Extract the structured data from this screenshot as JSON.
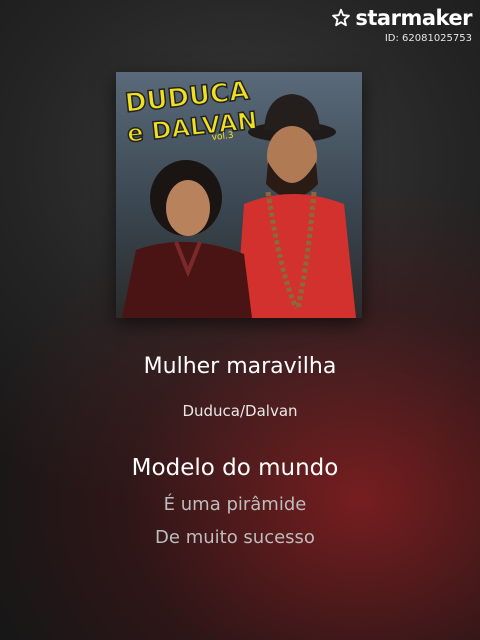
{
  "app": {
    "brand_name": "starmaker",
    "id_text": "ID: 62081025753",
    "logo_icon": "star-logo-icon"
  },
  "cover": {
    "title_line1": "DUDUCA",
    "title_line2": "e DALVAN",
    "volume": "vol.3",
    "accent_yellow": "#f0e020",
    "accent_red": "#d2312e"
  },
  "song": {
    "title": "Mulher maravilha",
    "artist": "Duduca/Dalvan"
  },
  "lyrics": {
    "current": "Modelo do mundo",
    "next": [
      "É uma pirâmide",
      "De muito sucesso"
    ]
  }
}
